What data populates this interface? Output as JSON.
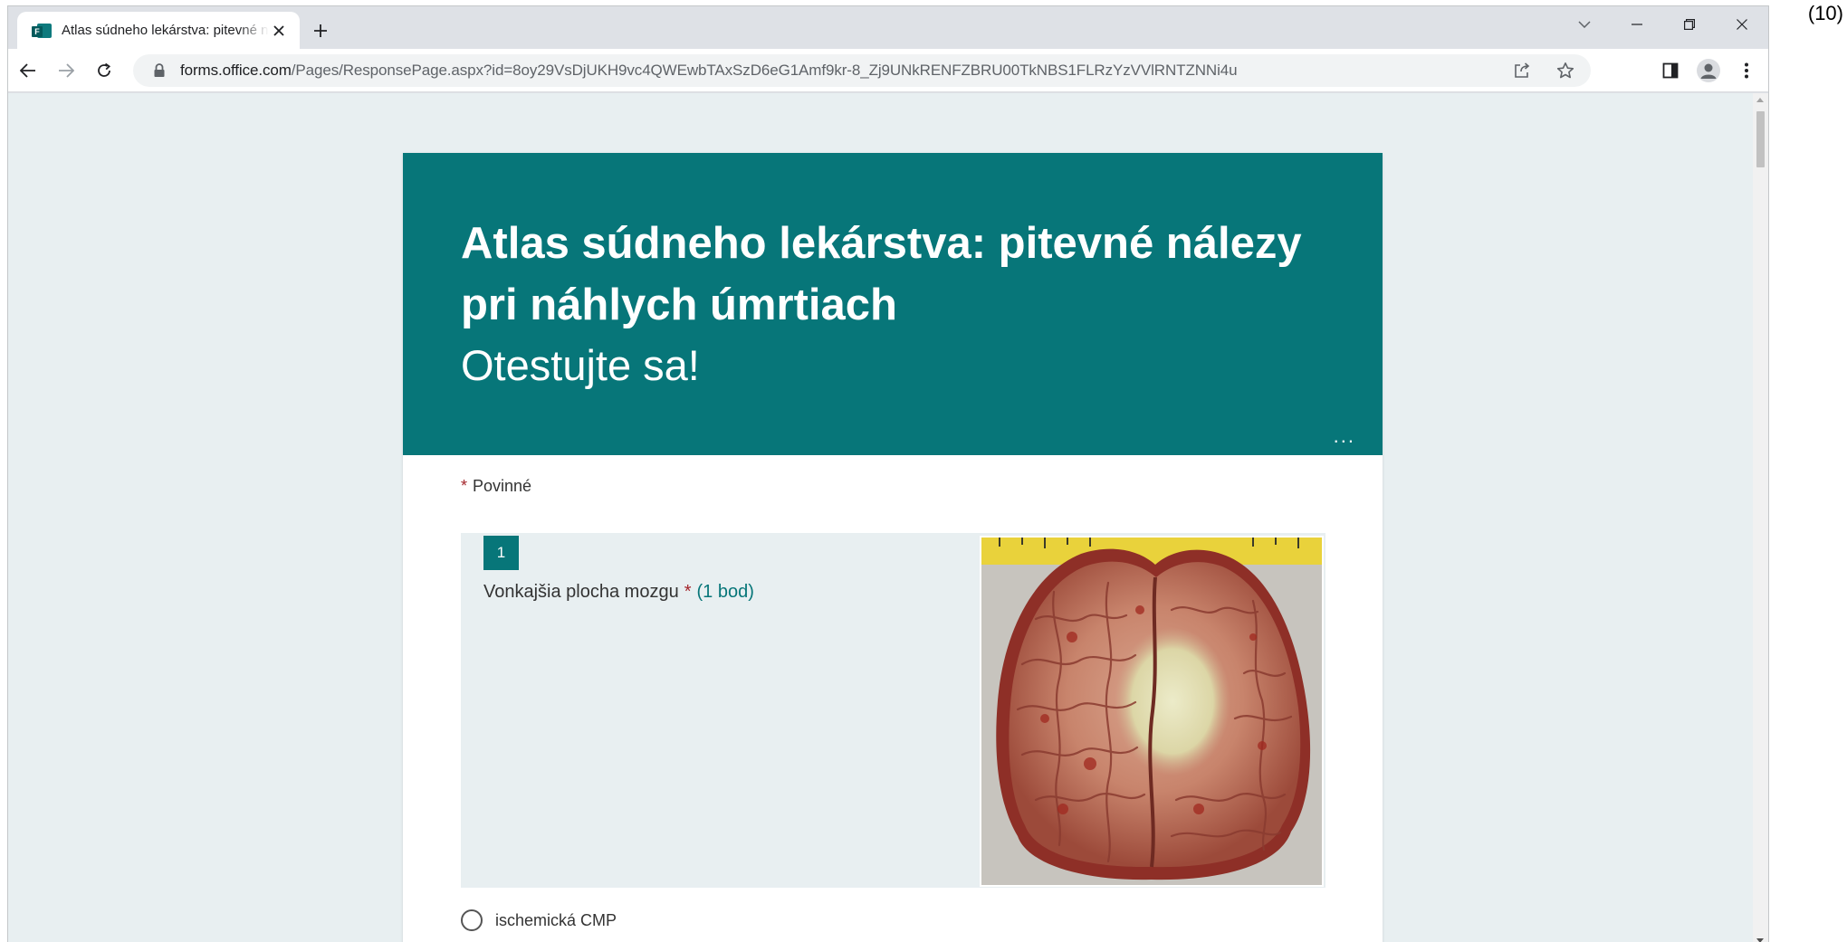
{
  "browser": {
    "tab_title": "Atlas súdneho lekárstva: pitevné nálezy pri náhlych úmrtiach",
    "url_domain": "forms.office.com",
    "url_path": "/Pages/ResponsePage.aspx?id=8oy29VsDjUKH9vc4QWEwbTAxSzD6eG1Amf9kr-8_Zj9UNkRENFZBRU00TkNBS1FLRzYzVVlRNTZNNi4u"
  },
  "form": {
    "title": "Atlas súdneho lekárstva: pitevné nálezy pri náhlych úmrtiach",
    "subtitle": "Otestujte sa!",
    "more_label": "...",
    "required_asterisk": "*",
    "required_label": "Povinné",
    "question": {
      "number": "1",
      "text": "Vonkajšia plocha mozgu",
      "asterisk": "*",
      "points": "(1 bod)",
      "image_icon": "brain-photo",
      "options": [
        "ischemická CMP"
      ]
    }
  },
  "figure_label": "(10)",
  "colors": {
    "accent": "#077679",
    "page_background": "#e8eff1",
    "required": "#a4262c"
  }
}
